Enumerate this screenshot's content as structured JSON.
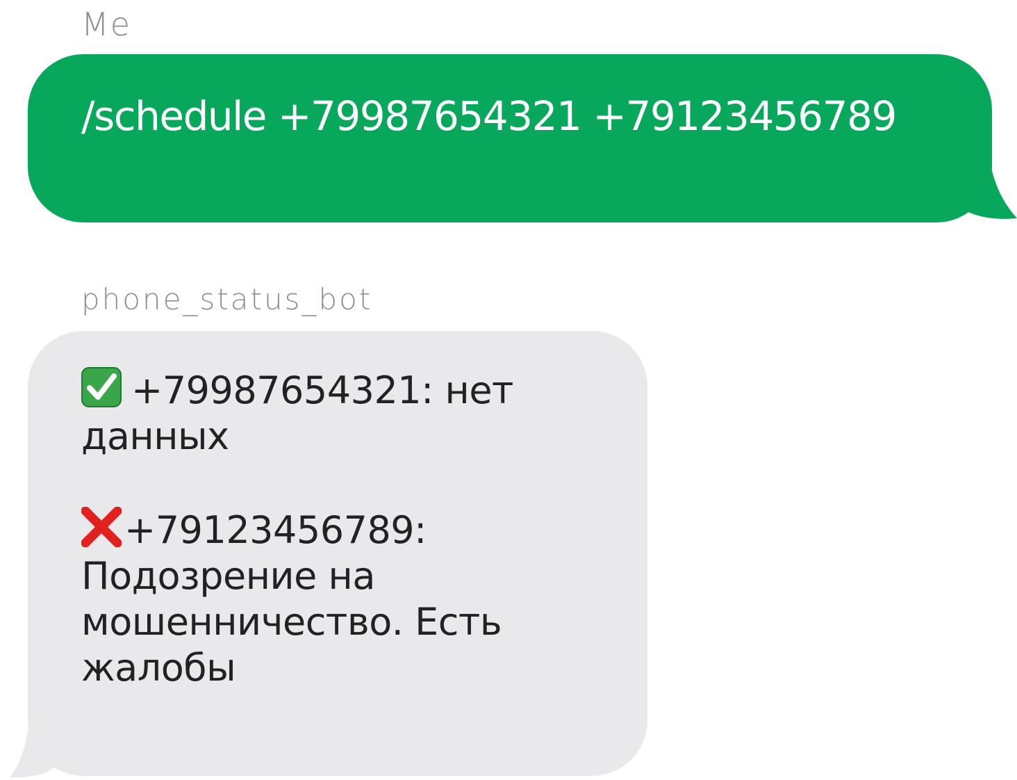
{
  "conversation": {
    "outgoing": {
      "sender": "Me",
      "text": "/schedule +79987654321 +79123456789",
      "bubble_color": "#07a85c",
      "text_color": "#ffffff"
    },
    "incoming": {
      "sender": "phone_status_bot",
      "bubble_color": "#e9e9eb",
      "text_color": "#222222",
      "results": [
        {
          "icon": "check-mark-button-icon",
          "line1": "+79987654321: нет",
          "line2": "данных"
        },
        {
          "icon": "cross-mark-icon",
          "line1": "+79123456789:",
          "line2": "Подозрение на",
          "line3": "мошенничество. Есть",
          "line4": "жалобы"
        }
      ]
    }
  }
}
